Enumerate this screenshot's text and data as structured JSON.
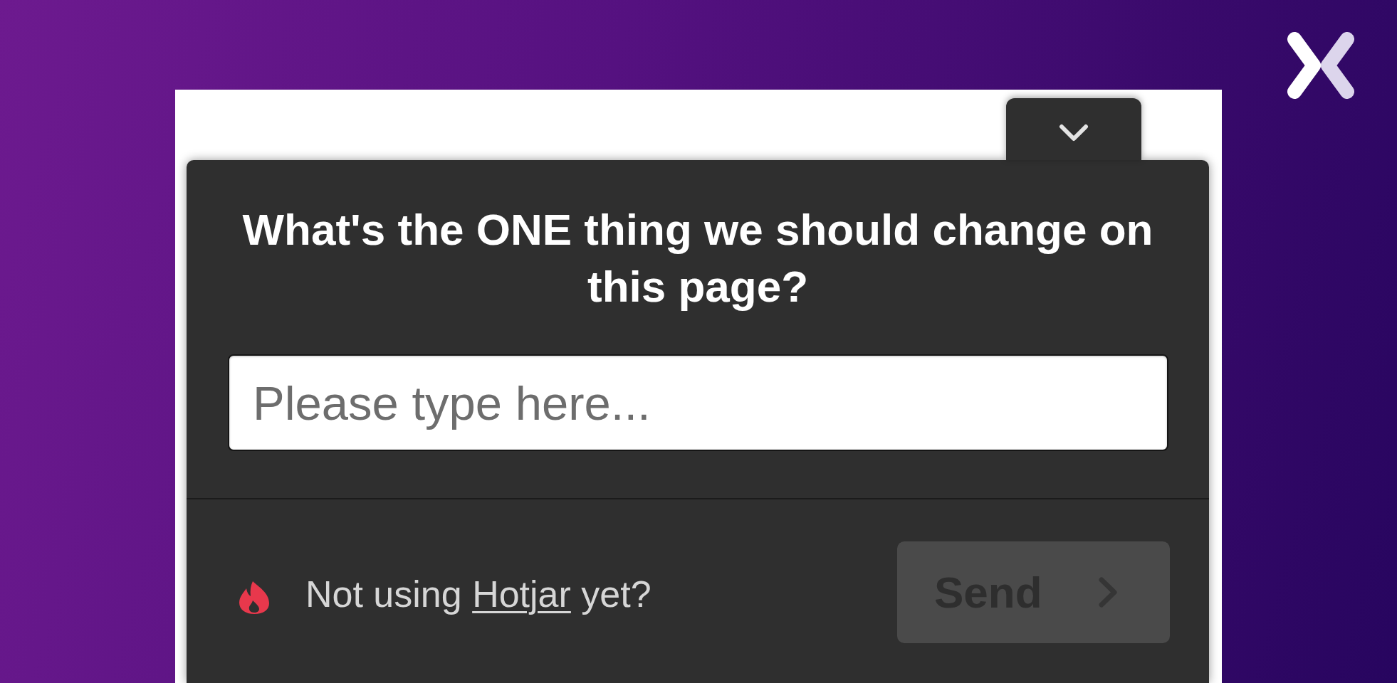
{
  "survey": {
    "question": "What's the ONE thing we should change on this page?",
    "answer_field": {
      "placeholder": "Please type here..."
    }
  },
  "footer": {
    "promo_before": "Not using",
    "promo_link": "Hotjar",
    "promo_after": "yet?",
    "send_button": {
      "label": "Send",
      "disabled": true
    }
  }
}
